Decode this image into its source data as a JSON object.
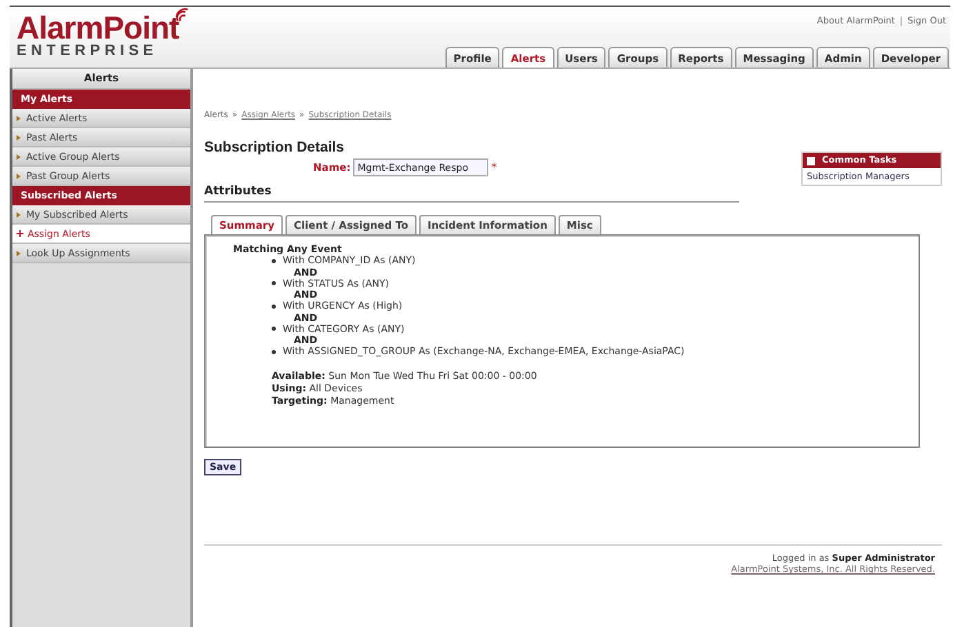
{
  "header": {
    "logo_main": "AlarmPoint",
    "logo_sub": "ENTERPRISE",
    "top_links": [
      {
        "text": "About AlarmPoint"
      },
      {
        "text": "Sign Out"
      }
    ],
    "tabs": [
      {
        "label": "Profile",
        "selected": false
      },
      {
        "label": "Alerts",
        "selected": true
      },
      {
        "label": "Users",
        "selected": false
      },
      {
        "label": "Groups",
        "selected": false
      },
      {
        "label": "Reports",
        "selected": false
      },
      {
        "label": "Messaging",
        "selected": false
      },
      {
        "label": "Admin",
        "selected": false
      },
      {
        "label": "Developer",
        "selected": false
      }
    ]
  },
  "sidebar": {
    "title": "Alerts",
    "items": [
      {
        "kind": "section",
        "label": "My Alerts"
      },
      {
        "kind": "link",
        "label": "Active Alerts",
        "selected": false
      },
      {
        "kind": "link",
        "label": "Past Alerts",
        "selected": false
      },
      {
        "kind": "link",
        "label": "Active Group Alerts",
        "selected": false
      },
      {
        "kind": "link",
        "label": "Past Group Alerts",
        "selected": false
      },
      {
        "kind": "section",
        "label": "Subscribed Alerts"
      },
      {
        "kind": "link",
        "label": "My Subscribed Alerts",
        "selected": false
      },
      {
        "kind": "link",
        "label": "Assign Alerts",
        "selected": true
      },
      {
        "kind": "link",
        "label": "Look Up Assignments",
        "selected": false
      }
    ]
  },
  "breadcrumb": [
    {
      "kind": "text",
      "text": "Alerts"
    },
    {
      "kind": "sep",
      "text": "»"
    },
    {
      "kind": "link",
      "text": "Assign Alerts"
    },
    {
      "kind": "sep",
      "text": "»"
    },
    {
      "kind": "link",
      "text": "Subscription Details"
    }
  ],
  "page_title": "Subscription Details",
  "common_tasks": {
    "title": "Common Tasks",
    "links": [
      "Subscription Managers"
    ]
  },
  "name_field": {
    "label": "Name:",
    "value": "Mgmt-Exchange Respo",
    "required_mark": "*"
  },
  "section_title": "Attributes",
  "attr_tabs": [
    {
      "label": "Summary",
      "selected": true
    },
    {
      "label": "Client / Assigned To",
      "selected": false
    },
    {
      "label": "Incident Information",
      "selected": false
    },
    {
      "label": "Misc",
      "selected": false
    }
  ],
  "summary": {
    "heading": "Matching Any Event",
    "conditions": [
      {
        "kind": "condition",
        "text": "With COMPANY_ID As (ANY)"
      },
      {
        "kind": "connector",
        "text": "AND"
      },
      {
        "kind": "condition",
        "text": "With STATUS As (ANY)"
      },
      {
        "kind": "connector",
        "text": "AND"
      },
      {
        "kind": "condition",
        "text": "With URGENCY As (High)"
      },
      {
        "kind": "connector",
        "text": "AND"
      },
      {
        "kind": "condition",
        "text": "With CATEGORY As (ANY)"
      },
      {
        "kind": "connector",
        "text": "AND"
      },
      {
        "kind": "condition",
        "text": "With ASSIGNED_TO_GROUP As (Exchange-NA, Exchange-EMEA, Exchange-AsiaPAC)"
      }
    ],
    "details": [
      {
        "label": "Available:",
        "value": "Sun Mon Tue Wed Thu Fri Sat 00:00 - 00:00"
      },
      {
        "label": "Using:",
        "value": "All Devices"
      },
      {
        "label": "Targeting:",
        "value": "Management"
      }
    ]
  },
  "buttons": [
    "Save"
  ],
  "footer": {
    "login": "Logged in as **Super Administrator**",
    "copyright": "AlarmPoint Systems, Inc. All Rights Reserved."
  }
}
